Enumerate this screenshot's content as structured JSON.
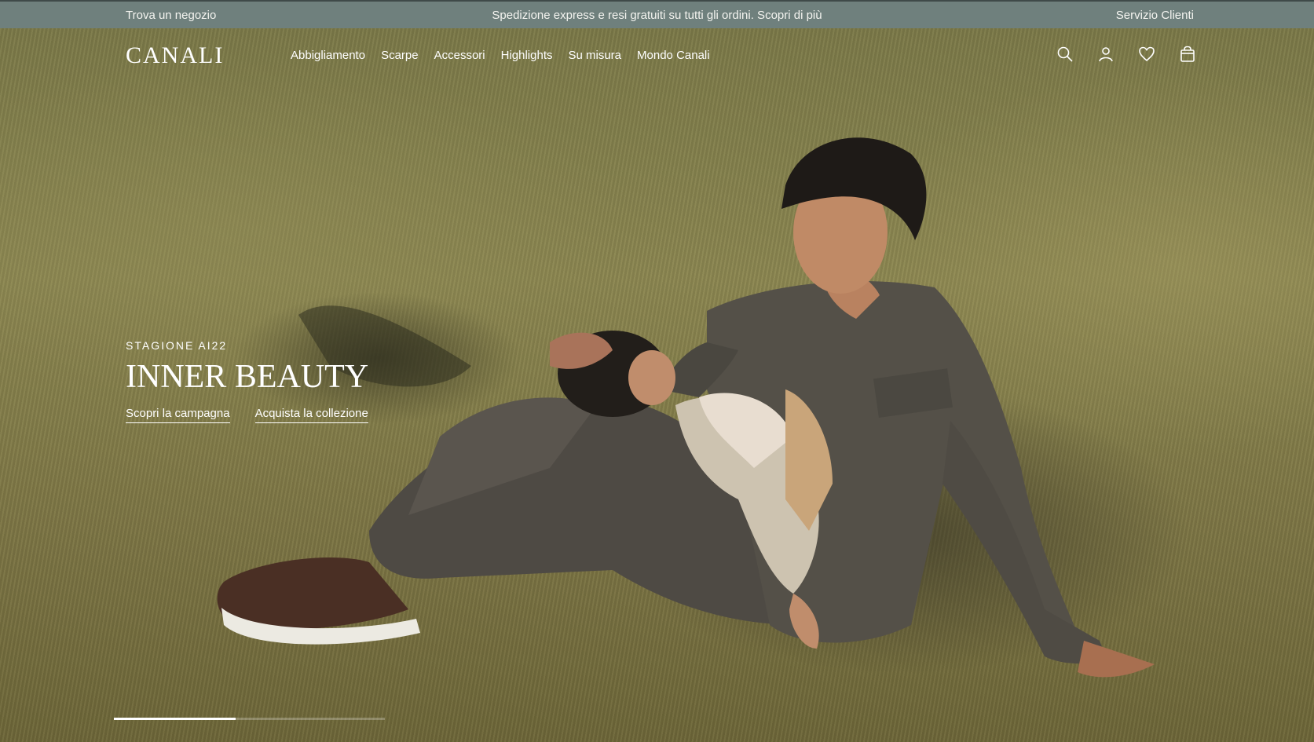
{
  "topbar": {
    "store_locator": "Trova un negozio",
    "announcement": "Spedizione express e resi gratuiti su tutti gli ordini. Scopri di più",
    "customer_service": "Servizio Clienti",
    "background": "#6f807d"
  },
  "header": {
    "logo": "CANALI",
    "menu": [
      "Abbigliamento",
      "Scarpe",
      "Accessori",
      "Highlights",
      "Su misura",
      "Mondo Canali"
    ],
    "icons": [
      "search-icon",
      "account-icon",
      "wishlist-heart-icon",
      "shopping-bag-icon"
    ]
  },
  "hero": {
    "eyebrow": "STAGIONE AI22",
    "headline": "INNER BEAUTY",
    "cta_primary": "Scopri la campagna",
    "cta_secondary": "Acquista la collezione",
    "image_description_icon": "hero-photo",
    "slide_progress": 0.45
  }
}
